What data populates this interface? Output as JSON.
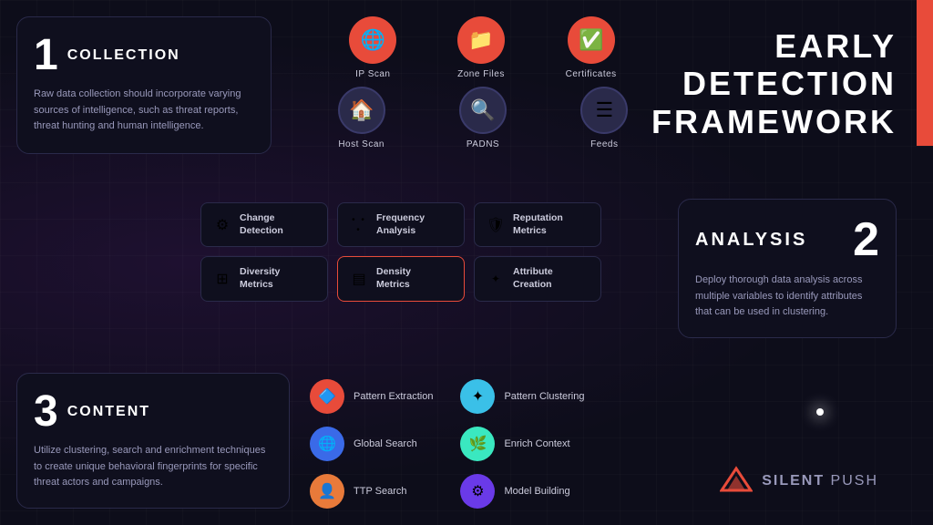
{
  "title": "Early Detection Framework",
  "redBar": {
    "label": "accent-bar"
  },
  "section1": {
    "number": "1",
    "title": "COLLECTION",
    "desc": "Raw data collection should incorporate varying sources of intelligence, such as threat reports, threat hunting and human intelligence."
  },
  "collectionIcons": {
    "topRow": [
      {
        "label": "IP Scan",
        "icon": "🌐",
        "style": "orange"
      },
      {
        "label": "Zone Files",
        "icon": "📁",
        "style": "orange"
      },
      {
        "label": "Certificates",
        "icon": "✅",
        "style": "orange"
      }
    ],
    "bottomRow": [
      {
        "label": "Host Scan",
        "icon": "🏠",
        "style": "dark"
      },
      {
        "label": "PADNS",
        "icon": "🔍",
        "style": "dark"
      },
      {
        "label": "Feeds",
        "icon": "☰",
        "style": "dark"
      }
    ]
  },
  "edfTitle": {
    "line1": "EARLY",
    "line2": "DETECTION",
    "line3": "FRAMEWORK"
  },
  "section2": {
    "number": "2",
    "title": "ANALYSIS",
    "desc": "Deploy thorough data analysis across multiple variables to identify attributes that can be used in clustering."
  },
  "metrics": {
    "row1": [
      {
        "label": "Change\nDetection",
        "icon": "⚙",
        "highlighted": false
      },
      {
        "label": "Frequency\nAnalysis",
        "icon": "···",
        "highlighted": false
      },
      {
        "label": "Reputation\nMetrics",
        "icon": "🛡",
        "highlighted": false
      }
    ],
    "row2": [
      {
        "label": "Diversity\nMetrics",
        "icon": "⊞",
        "highlighted": false
      },
      {
        "label": "Density\nMetrics",
        "icon": "▤",
        "highlighted": true
      },
      {
        "label": "Attribute\nCreation",
        "icon": "✦",
        "highlighted": false
      }
    ]
  },
  "section3": {
    "number": "3",
    "title": "CONTENT",
    "desc": "Utilize clustering, search and enrichment techniques to create unique behavioral fingerprints for specific threat actors and campaigns."
  },
  "contentItems": {
    "left": [
      {
        "label": "Pattern Extraction",
        "icon": "🔷",
        "style": "orange"
      },
      {
        "label": "Global Search",
        "icon": "🌐",
        "style": "blue"
      },
      {
        "label": "TTP Search",
        "icon": "👤",
        "style": "orange2"
      }
    ],
    "right": [
      {
        "label": "Pattern Clustering",
        "icon": "✦",
        "style": "cyan"
      },
      {
        "label": "Enrich Context",
        "icon": "🌿",
        "style": "teal"
      },
      {
        "label": "Model Building",
        "icon": "⚙",
        "style": "purple"
      }
    ]
  },
  "silentPush": {
    "icon": "▲",
    "text_bold": "SILENT",
    "text_light": " PUSH"
  }
}
